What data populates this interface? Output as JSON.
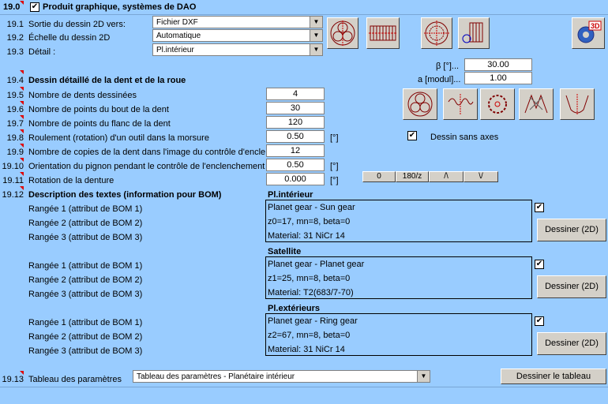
{
  "header": {
    "num": "19.0",
    "title": "Produit graphique, systèmes de DAO",
    "checked": "✔"
  },
  "rows": [
    {
      "num": "19.1",
      "label": "Sortie du dessin 2D vers:"
    },
    {
      "num": "19.2",
      "label": "Échelle du dessin 2D"
    },
    {
      "num": "19.3",
      "label": "Détail :"
    }
  ],
  "combos": {
    "output": "Fichier DXF",
    "scale": "Automatique",
    "detail": "Pl.intérieur",
    "table": "Tableau des paramètres - Planétaire intérieur"
  },
  "beta": {
    "label": "β [°]...",
    "value": "30.00"
  },
  "module": {
    "label": "a [modul]...",
    "value": "1.00"
  },
  "section194": {
    "num": "19.4",
    "title": "Dessin détaillé de la dent et de la roue"
  },
  "params": [
    {
      "num": "19.5",
      "label": "Nombre de dents dessinées",
      "value": "4",
      "unit": ""
    },
    {
      "num": "19.6",
      "label": "Nombre de points du bout de la dent",
      "value": "30",
      "unit": ""
    },
    {
      "num": "19.7",
      "label": "Nombre de points du flanc de la dent",
      "value": "120",
      "unit": ""
    },
    {
      "num": "19.8",
      "label": "Roulement (rotation) d'un outil dans la morsure",
      "value": "0.50",
      "unit": "[°]"
    },
    {
      "num": "19.9",
      "label": "Nombre de copies de la dent dans l'image du contrôle d'enclenc",
      "value": "12",
      "unit": ""
    },
    {
      "num": "19.10",
      "label": "Orientation du pignon pendant le contrôle de l'enclenchement",
      "value": "0.50",
      "unit": "[°]"
    },
    {
      "num": "19.11",
      "label": "Rotation de la denture",
      "value": "0.000",
      "unit": "[°]"
    }
  ],
  "no_axes": {
    "label": "Dessin sans axes",
    "checked": "✔"
  },
  "rotation_buttons": [
    "0",
    "180/z",
    "/\\",
    "\\/"
  ],
  "section1912": {
    "num": "19.12",
    "title": "Description des textes (information pour BOM)"
  },
  "groups": [
    {
      "title": "Pl.intérieur",
      "rows": [
        "Rangée 1 (attribut de BOM 1)",
        "Rangée 2 (attribut de BOM 2)",
        "Rangée 3 (attribut de BOM 3)"
      ],
      "texts": [
        "Planet gear - Sun gear",
        "z0=17, mn=8, beta=0",
        "Material: 31 NiCr 14"
      ],
      "checked": "✔",
      "button": "Dessiner (2D)"
    },
    {
      "title": "Satellite",
      "rows": [
        "Rangée 1 (attribut de BOM 1)",
        "Rangée 2 (attribut de BOM 2)",
        "Rangée 3 (attribut de BOM 3)"
      ],
      "texts": [
        "Planet gear - Planet gear",
        "z1=25, mn=8, beta=0",
        "Material: T2(683/7-70)"
      ],
      "checked": "✔",
      "button": "Dessiner (2D)"
    },
    {
      "title": "Pl.extérieurs",
      "rows": [
        "Rangée 1 (attribut de BOM 1)",
        "Rangée 2 (attribut de BOM 2)",
        "Rangée 3 (attribut de BOM 3)"
      ],
      "texts": [
        "Planet gear - Ring gear",
        "z2=67, mn=8, beta=0",
        "Material: 31 NiCr 14"
      ],
      "checked": "✔",
      "button": "Dessiner (2D)"
    }
  ],
  "section1913": {
    "num": "19.13",
    "label": "Tableau des paramètres",
    "button": "Dessiner le tableau"
  },
  "icon3d": "3D"
}
